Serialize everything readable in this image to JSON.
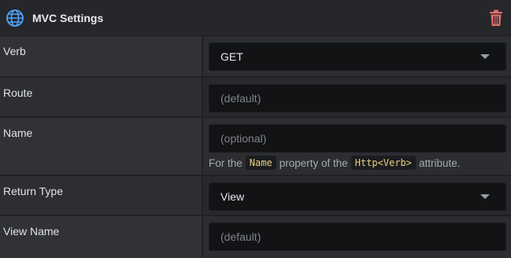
{
  "header": {
    "title": "MVC Settings",
    "icon": "globe-icon",
    "delete_icon": "trash-icon",
    "delete_color": "#e06c6c",
    "globe_color": "#4da3ff"
  },
  "rows": {
    "verb": {
      "label": "Verb",
      "value": "GET"
    },
    "route": {
      "label": "Route",
      "placeholder": "(default)"
    },
    "name": {
      "label": "Name",
      "placeholder": "(optional)",
      "hint_prefix": "For the",
      "hint_code1": "Name",
      "hint_mid": "property of the",
      "hint_code2": "Http<Verb>",
      "hint_suffix": "attribute."
    },
    "return_type": {
      "label": "Return Type",
      "value": "View"
    },
    "view_name": {
      "label": "View Name",
      "placeholder": "(default)"
    }
  }
}
